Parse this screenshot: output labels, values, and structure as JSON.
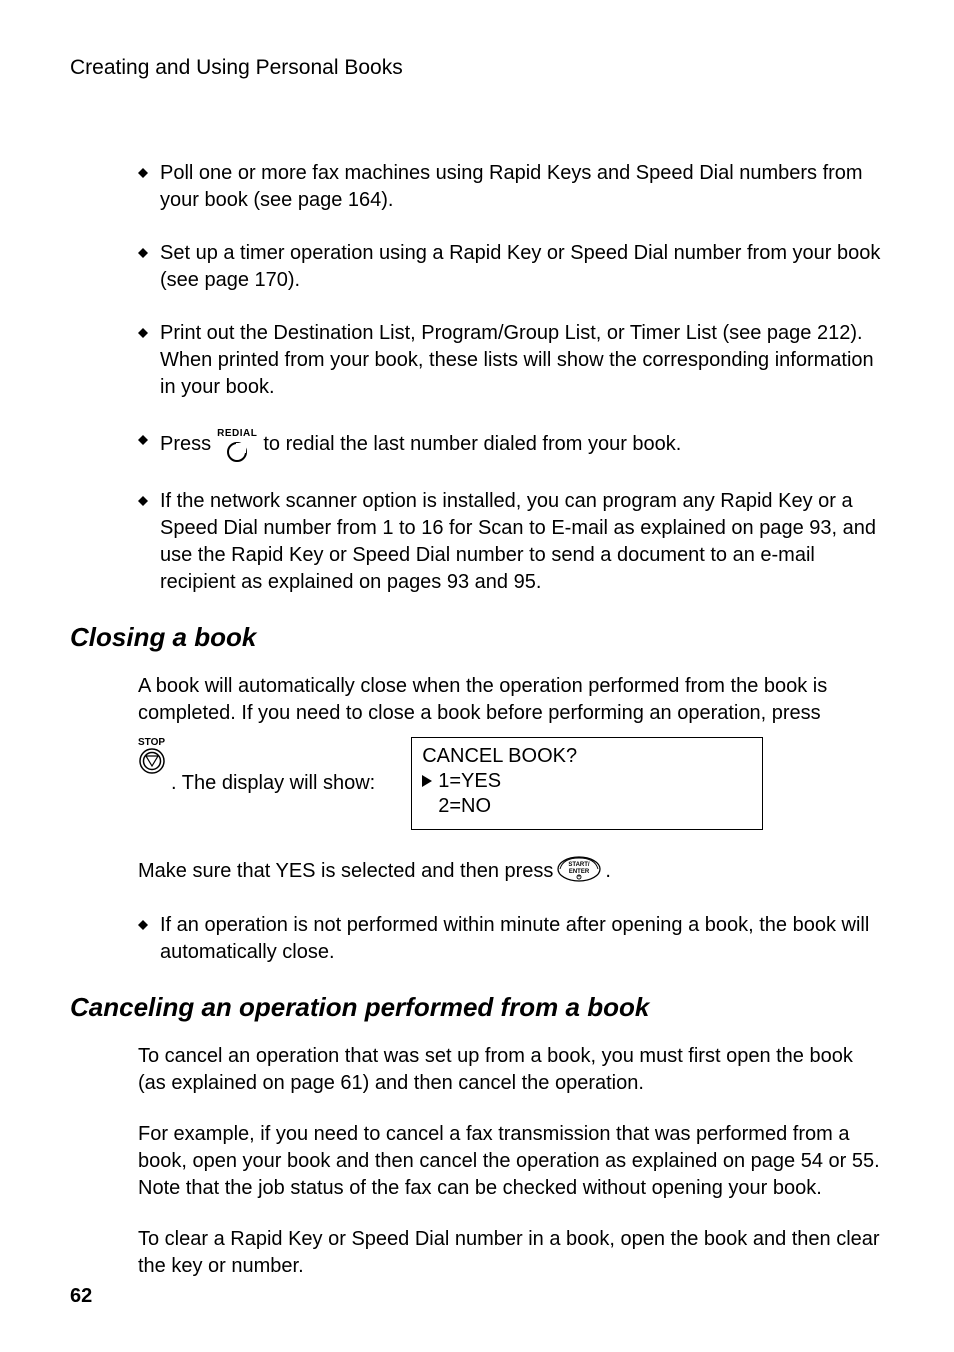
{
  "runningHead": "Creating and Using Personal Books",
  "bullets": {
    "b1": "Poll one or more fax machines using Rapid Keys and Speed Dial numbers from your book (see page 164).",
    "b2": "Set up a timer operation using a Rapid Key or Speed Dial number from your book (see page 170).",
    "b3": "Print out the Destination List, Program/Group List, or Timer List (see page 212). When printed from your book, these lists will show the corresponding information in your book.",
    "b4_pre": "Press ",
    "b4_post": " to redial the last number dialed from your book.",
    "b5": "If the network scanner option is installed, you can program any Rapid Key or a Speed Dial number from 1 to 16 for Scan to E-mail as explained on page 93, and use the Rapid Key or Speed Dial number to send a document to an e-mail recipient as explained on pages 93 and 95."
  },
  "redialLabel": "REDIAL",
  "closing": {
    "heading": "Closing a book",
    "p1": "A book will automatically close when the operation performed from the book is completed. If you need to close a book before performing an operation, press",
    "stopLabel": "STOP",
    "displayIntro": ". The display will show:",
    "display": {
      "line1": "CANCEL BOOK?",
      "line2": "1=YES",
      "line3": "2=NO"
    },
    "p3_pre": "Make sure that YES is selected and then press ",
    "p3_post": ".",
    "enterLabel1": "START/",
    "enterLabel2": "ENTER",
    "b1": "If an operation is not performed within minute after opening a book, the book will automatically close."
  },
  "cancel": {
    "heading": "Canceling an operation performed from a book",
    "p1": "To cancel an operation that was set up from a book, you must first open the book (as explained on page 61) and then cancel the operation.",
    "p2": "For example, if you need to cancel a fax transmission that was performed from a book, open your book and then cancel the operation as explained on page 54 or 55. Note that the job status of the fax can be checked without opening your book.",
    "p3": "To clear a Rapid Key or Speed Dial number in a book, open the book and then clear the key or number."
  },
  "pageNumber": "62"
}
